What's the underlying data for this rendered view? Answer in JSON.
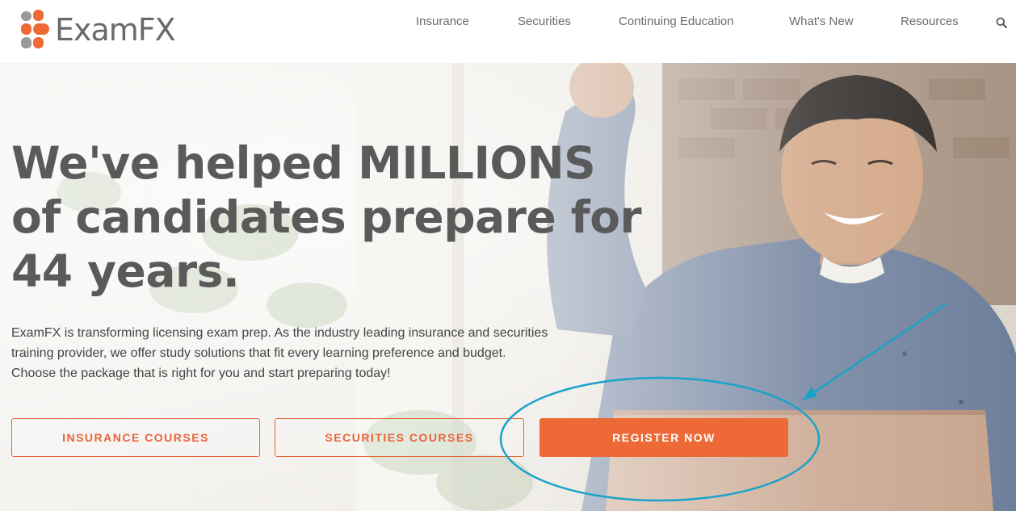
{
  "brand": {
    "name": "ExamFX",
    "colors": {
      "orange": "#ed6a36",
      "gray": "#8a8a8a",
      "annotation": "#1aa3c8"
    }
  },
  "nav": {
    "items": [
      {
        "label": "Insurance"
      },
      {
        "label": "Securities"
      },
      {
        "label": "Continuing Education"
      },
      {
        "label": "What's New"
      },
      {
        "label": "Resources"
      }
    ],
    "search_icon": "search-icon"
  },
  "hero": {
    "headline_lines": [
      "We've helped MILLIONS",
      "of candidates prepare for",
      "44 years."
    ],
    "intro_lines": [
      "ExamFX is transforming licensing exam prep. As the industry leading insurance and securities",
      "training provider, we offer study solutions that fit every learning preference and budget.",
      "Choose the package that is right for you and start preparing today!"
    ],
    "buttons": {
      "insurance": "INSURANCE COURSES",
      "securities": "SECURITIES COURSES",
      "register": "REGISTER NOW"
    }
  }
}
